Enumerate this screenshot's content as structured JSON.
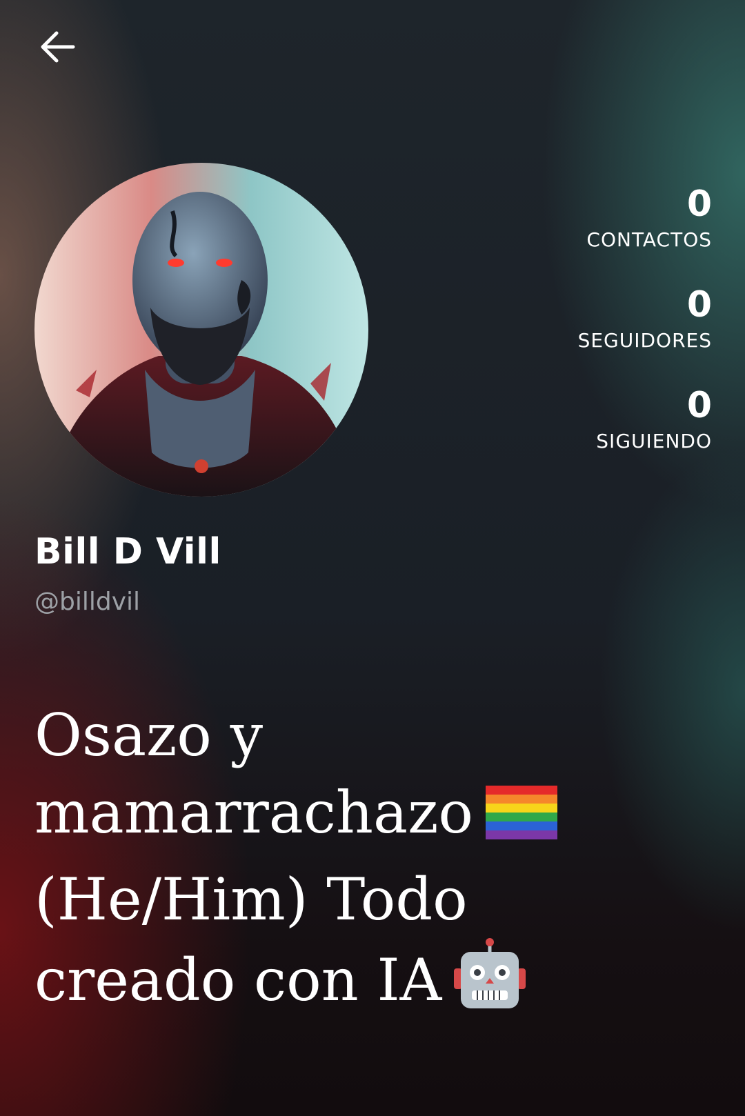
{
  "header": {
    "back_icon": "arrow-left-icon"
  },
  "profile": {
    "avatar_description_icon": "avatar-photo",
    "name": "Bill D Vill",
    "handle": "@billdvil",
    "bio_lines": [
      "Osazo y",
      "mamarrachazo",
      "(He/Him) Todo",
      "creado con IA"
    ],
    "bio_emojis": [
      "rainbow-flag-icon",
      "robot-icon"
    ]
  },
  "stats": [
    {
      "value": "0",
      "label": "CONTACTOS"
    },
    {
      "value": "0",
      "label": "SEGUIDORES"
    },
    {
      "value": "0",
      "label": "SIGUIENDO"
    }
  ],
  "colors": {
    "text": "#ffffff",
    "handle": "#9da1a6",
    "teal_glow": "#347068",
    "red_glow": "#78121a"
  }
}
